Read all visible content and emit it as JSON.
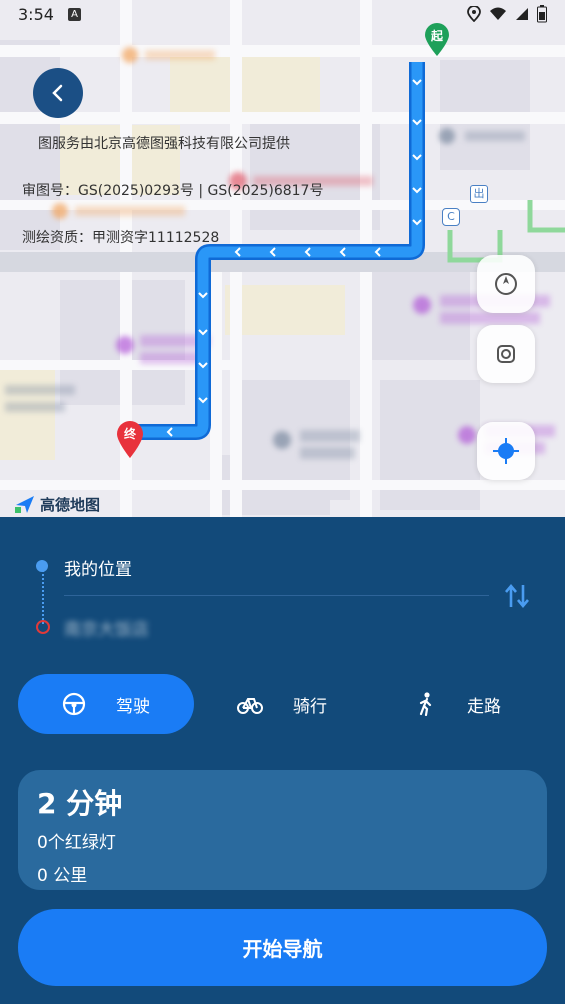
{
  "status_bar": {
    "time": "3:54",
    "sim_label": "A"
  },
  "map": {
    "copyright_lines": [
      "图服务由北京高德图强科技有限公司提供",
      "审图号：GS(2025)0293号 | GS(2025)6817号",
      "测绘资质：甲测资字11112528"
    ],
    "logo_text": "高德地图",
    "start_marker": "起",
    "end_marker": "终",
    "route_color": "#1a8af5",
    "poi_purple": "#b25ad8",
    "poi_orange": "#f2a35b"
  },
  "route": {
    "origin_label": "我的位置",
    "destination_label": "南京大饭店"
  },
  "modes": [
    {
      "label": "驾驶",
      "icon": "steering-wheel-icon",
      "active": true
    },
    {
      "label": "骑行",
      "icon": "bicycle-icon",
      "active": false
    },
    {
      "label": "走路",
      "icon": "walking-icon",
      "active": false
    }
  ],
  "summary": {
    "duration": "2 分钟",
    "traffic_lights": "0个红绿灯",
    "distance": "0 公里"
  },
  "start_button": {
    "label": "开始导航"
  },
  "colors": {
    "panel_bg": "#124a7a",
    "accent": "#1a7cf5",
    "card_bg": "#2a6a9e"
  }
}
